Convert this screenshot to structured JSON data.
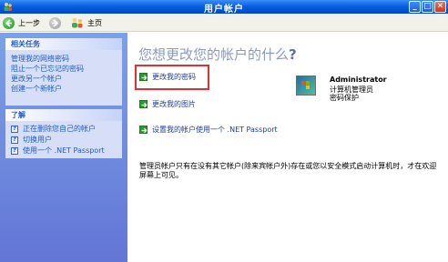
{
  "window": {
    "title": "用户帐户",
    "minimize_label": "_",
    "maximize_label": "□",
    "close_label": "✕"
  },
  "toolbar": {
    "back_label": "上一步",
    "home_label": "主页"
  },
  "sidebar": {
    "related_tasks": {
      "title": "相关任务",
      "items": [
        "管理我的网络密码",
        "阻止一个已忘记的密码",
        "更改另一个帐户",
        "创建一个新帐户"
      ]
    },
    "learn": {
      "title": "了解",
      "items": [
        "正在删除您自己的帐户",
        "切换用户",
        "使用一个 .NET Passport"
      ]
    }
  },
  "main": {
    "heading": "您想更改您的帐户的什么",
    "heading_mark": "?",
    "tasks": [
      "更改我的密码",
      "更改我的图片",
      "设置我的帐户使用一个 .NET Passport"
    ],
    "user": {
      "name": "Administrator",
      "type": "计算机管理员",
      "protection": "密码保护"
    },
    "note": "管理员帐户只有在没有其它帐户(除来宾帐户外)存在或您以安全模式启动计算机时，才在欢迎屏幕上可见。"
  },
  "colors": {
    "titlebar": "#0a5fe0",
    "sidebar": "#6f8ee0",
    "link": "#215dc6",
    "highlight": "#e03030",
    "task_arrow": "#2e9a2e"
  },
  "icons": {
    "app": "user-accounts-icon",
    "back": "back-arrow-icon",
    "forward": "forward-arrow-icon",
    "home": "home-users-icon",
    "help": "help-icon",
    "task": "green-arrow-icon",
    "avatar": "user-picture"
  }
}
